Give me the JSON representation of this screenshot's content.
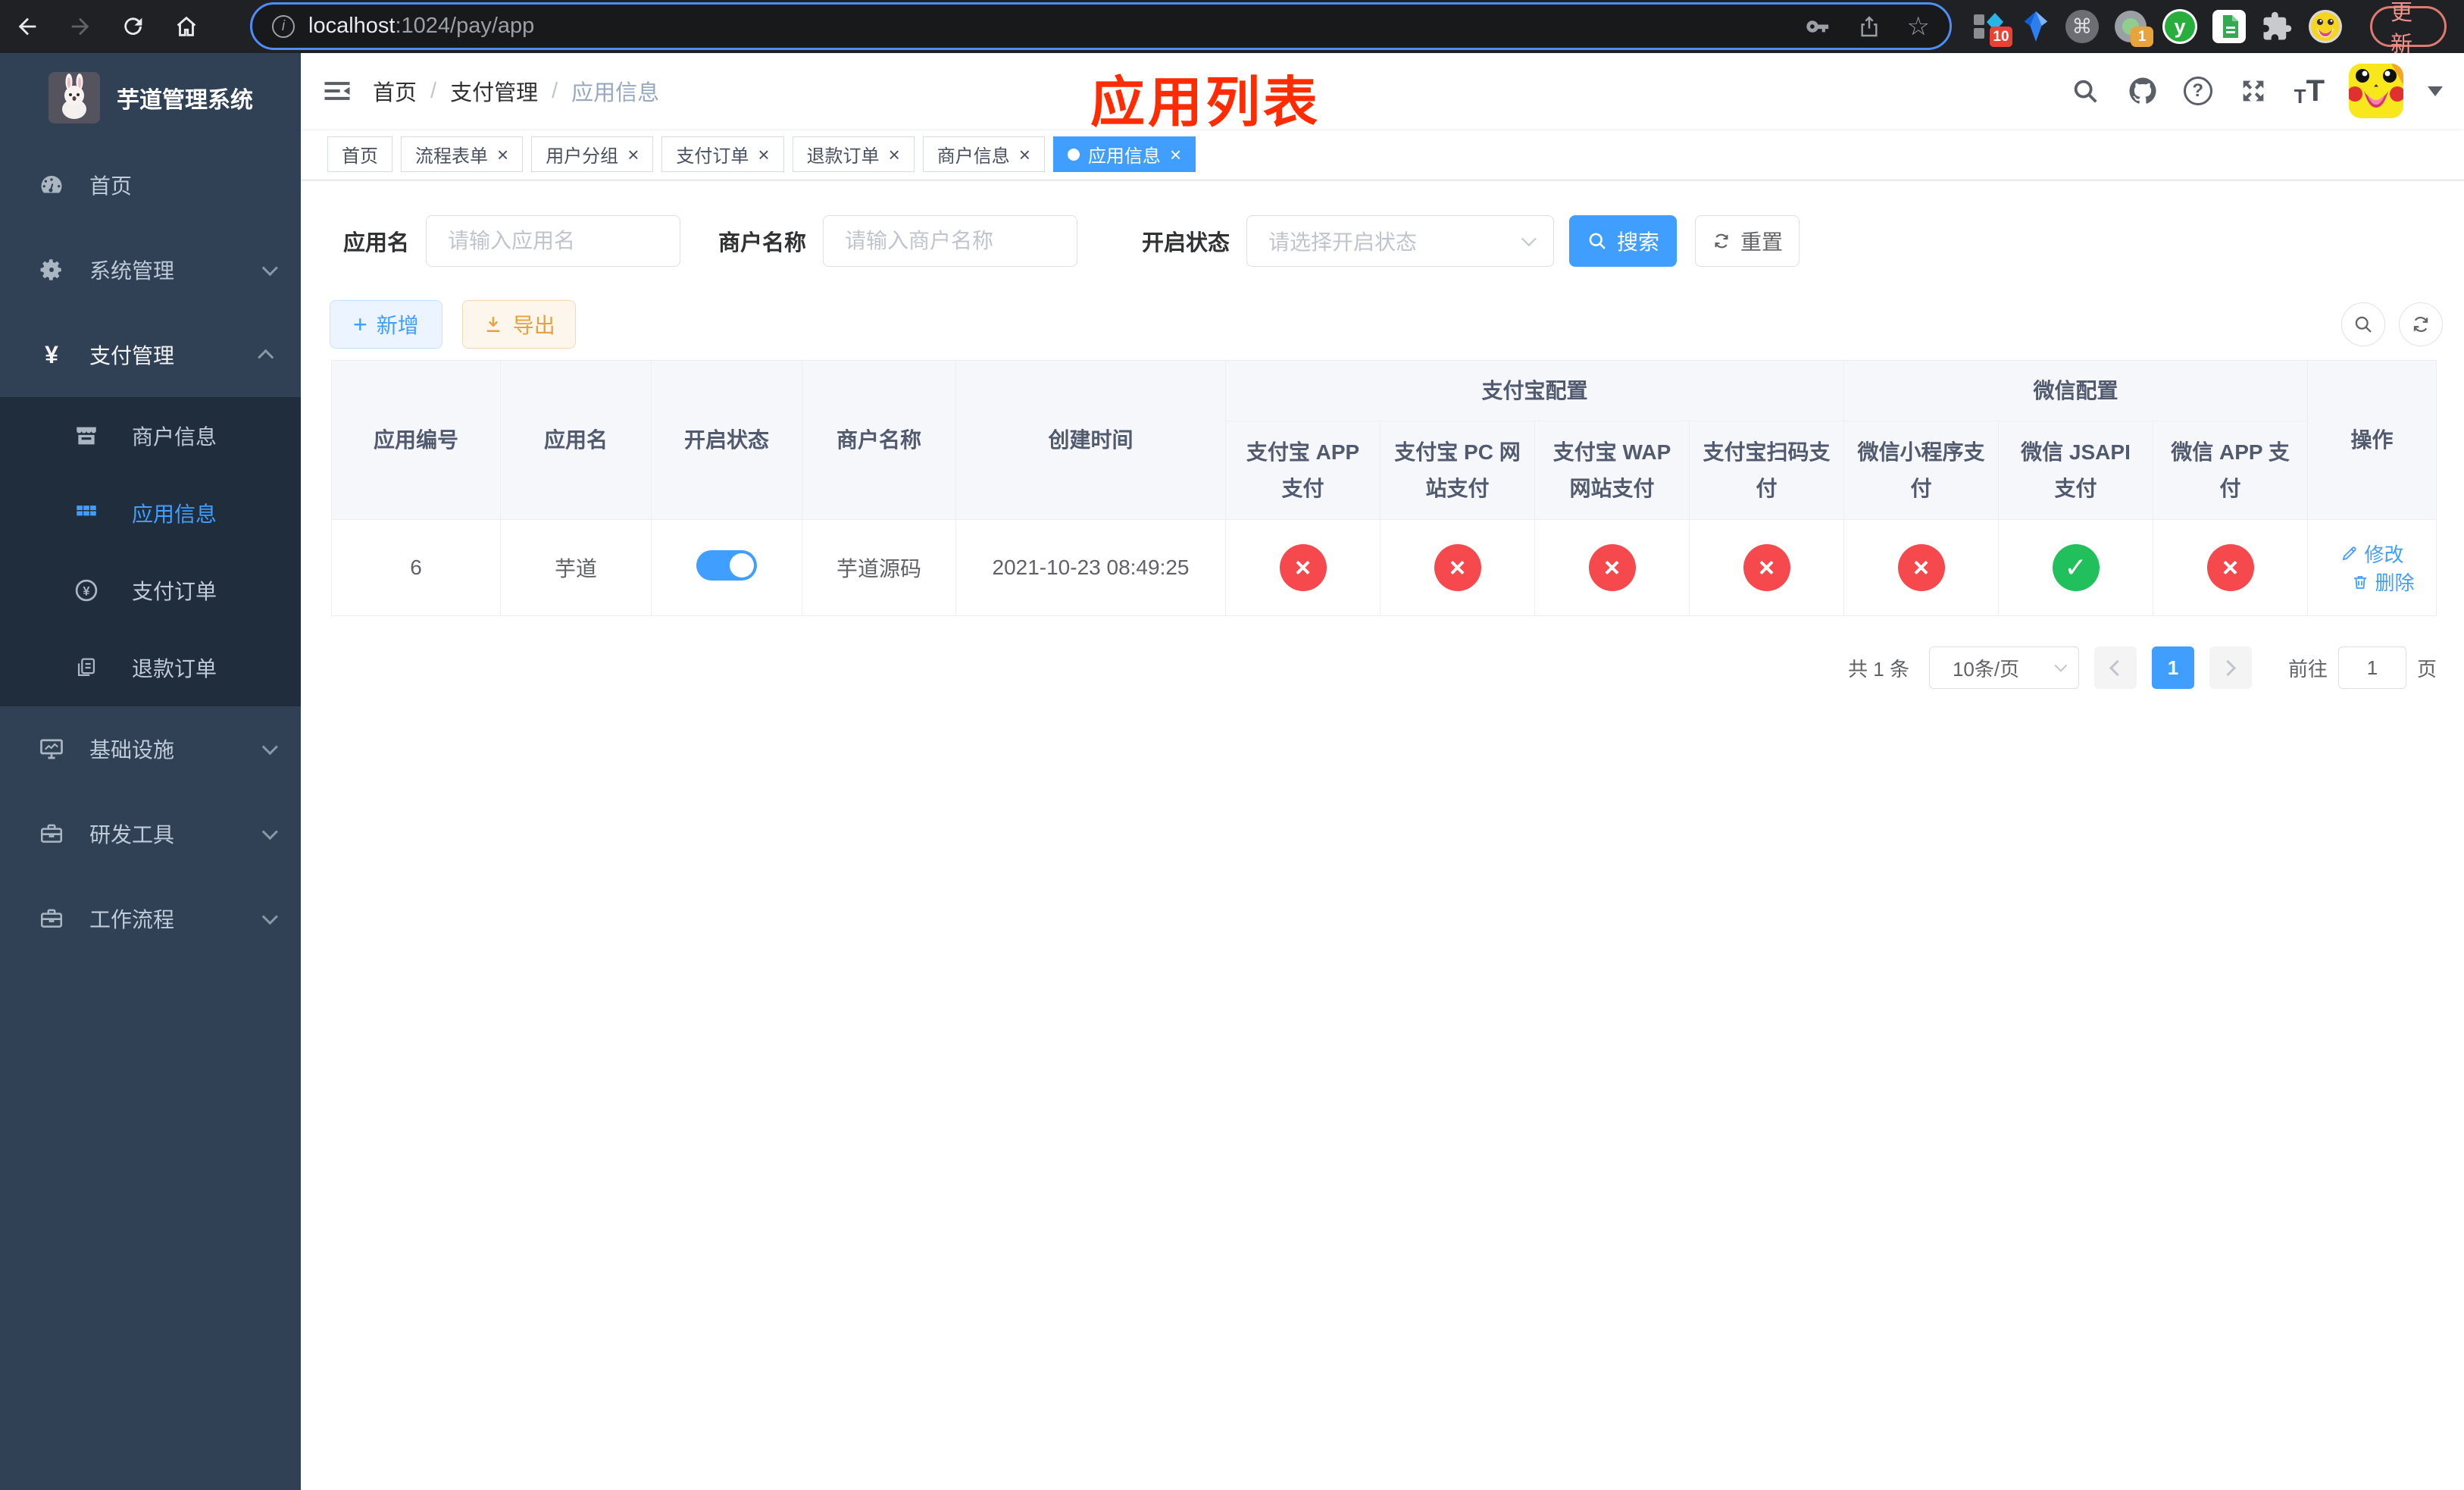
{
  "colors": {
    "primary": "#409EFF",
    "danger": "#f5494d",
    "success": "#22c05c",
    "annotation": "#ff2b01",
    "warning": "#e6a23c",
    "sidebar-bg": "#304156",
    "submenu-bg": "#1f2d3d",
    "sidebar-text": "#bfcbd9"
  },
  "browser": {
    "url_host": "localhost",
    "url_path": ":1024/pay/app",
    "update_button": "更新",
    "ext_badge_10": "10",
    "ext_badge_1": "1",
    "ext_y_letter": "y"
  },
  "sidebar": {
    "app_title": "芋道管理系统",
    "items": [
      {
        "label": "首页"
      },
      {
        "label": "系统管理"
      },
      {
        "label": "支付管理"
      },
      {
        "label": "商户信息"
      },
      {
        "label": "应用信息"
      },
      {
        "label": "支付订单"
      },
      {
        "label": "退款订单"
      },
      {
        "label": "基础设施"
      },
      {
        "label": "研发工具"
      },
      {
        "label": "工作流程"
      }
    ]
  },
  "navbar": {
    "breadcrumb": [
      "首页",
      "支付管理",
      "应用信息"
    ],
    "separator": "/",
    "annotation": "应用列表"
  },
  "tabs": [
    {
      "label": "首页"
    },
    {
      "label": "流程表单"
    },
    {
      "label": "用户分组"
    },
    {
      "label": "支付订单"
    },
    {
      "label": "退款订单"
    },
    {
      "label": "商户信息"
    },
    {
      "label": "应用信息"
    }
  ],
  "filters": {
    "app_name_label": "应用名",
    "app_name_placeholder": "请输入应用名",
    "merchant_label": "商户名称",
    "merchant_placeholder": "请输入商户名称",
    "status_label": "开启状态",
    "status_placeholder": "请选择开启状态",
    "search_button": "搜索",
    "reset_button": "重置"
  },
  "toolbar": {
    "add_button": "新增",
    "export_button": "导出"
  },
  "table": {
    "columns": {
      "app_id": "应用编号",
      "app_name": "应用名",
      "open_status": "开启状态",
      "merchant_name": "商户名称",
      "create_time": "创建时间",
      "alipay_group": "支付宝配置",
      "wechat_group": "微信配置",
      "alipay_app": "支付宝 APP 支付",
      "alipay_pc": "支付宝 PC 网站支付",
      "alipay_wap": "支付宝 WAP 网站支付",
      "alipay_qr": "支付宝扫码支付",
      "wechat_lite": "微信小程序支付",
      "wechat_jsapi": "微信 JSAPI 支付",
      "wechat_app": "微信 APP 支付",
      "actions": "操作"
    },
    "row": {
      "app_id": "6",
      "app_name": "芋道",
      "open_status": "on",
      "merchant_name": "芋道源码",
      "create_time": "2021-10-23 08:49:25",
      "pay_statuses": [
        "disabled",
        "disabled",
        "disabled",
        "disabled",
        "disabled",
        "enabled",
        "disabled"
      ],
      "edit_action": "修改",
      "delete_action": "删除"
    }
  },
  "pagination": {
    "total_text": "共 1 条",
    "page_size": "10条/页",
    "current_page": "1",
    "goto_label": "前往",
    "goto_value": "1",
    "goto_unit": "页"
  },
  "icons": {
    "close": "×",
    "plus": "+",
    "yuan": "¥",
    "question": "?",
    "command": "⌘",
    "star": "☆",
    "dots": "⋮",
    "check": "✓",
    "cross": "×",
    "info": "i",
    "font_small": "T",
    "font_big": "T"
  }
}
